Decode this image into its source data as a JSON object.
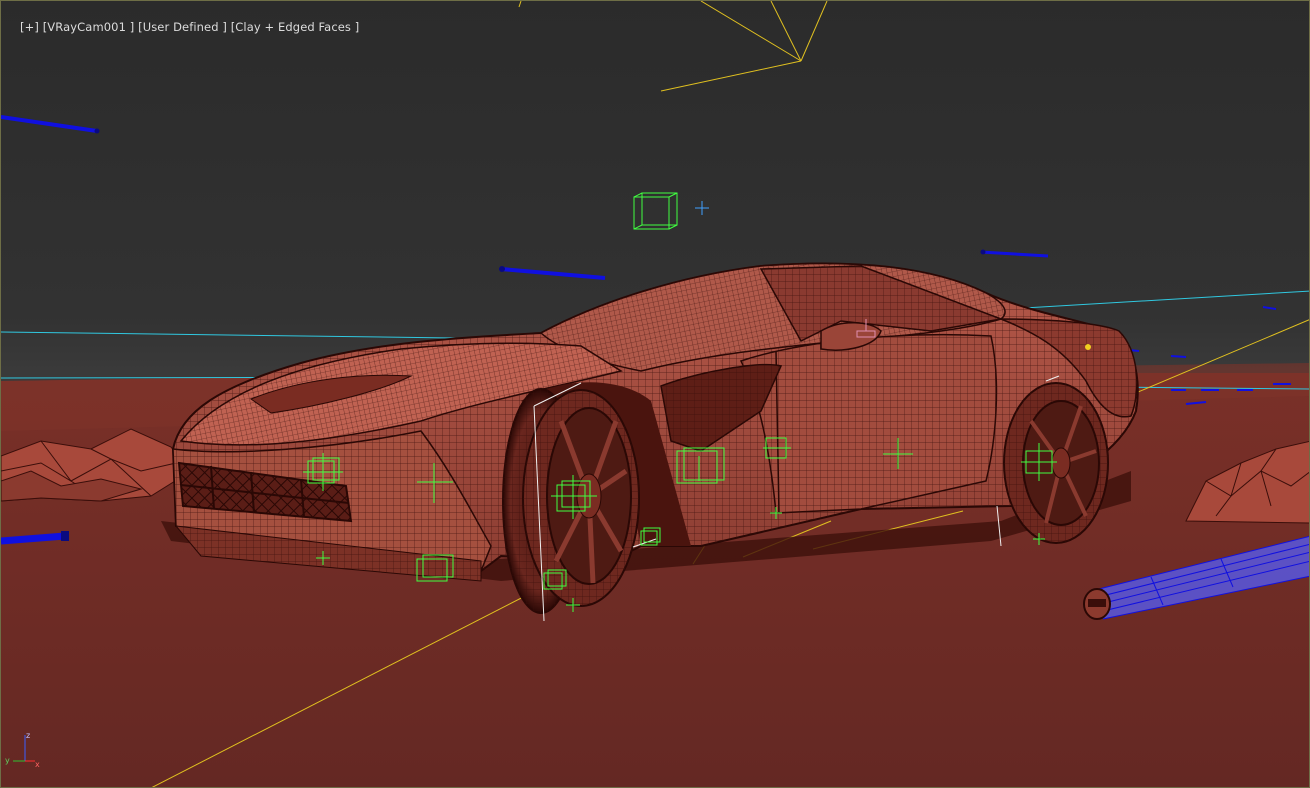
{
  "viewport": {
    "label_parts": {
      "plus": "[+]",
      "camera": "[VRayCam001 ]",
      "view": "[User Defined ]",
      "shading": "[Clay + Edged Faces ]"
    },
    "axis": {
      "z": "z",
      "y": "y",
      "x": "x"
    }
  },
  "colors": {
    "sky_top": "#2b2b2b",
    "ground": "#6b2b24",
    "car_body": "#9a4a3e",
    "wire": "#3a0e0a",
    "helper_green": "#40ff40",
    "light_blue": "#1010e0",
    "target_yellow": "#e0c020",
    "horizon_cyan": "#30c8e0"
  },
  "icons": [
    "axis-gizmo-icon"
  ]
}
